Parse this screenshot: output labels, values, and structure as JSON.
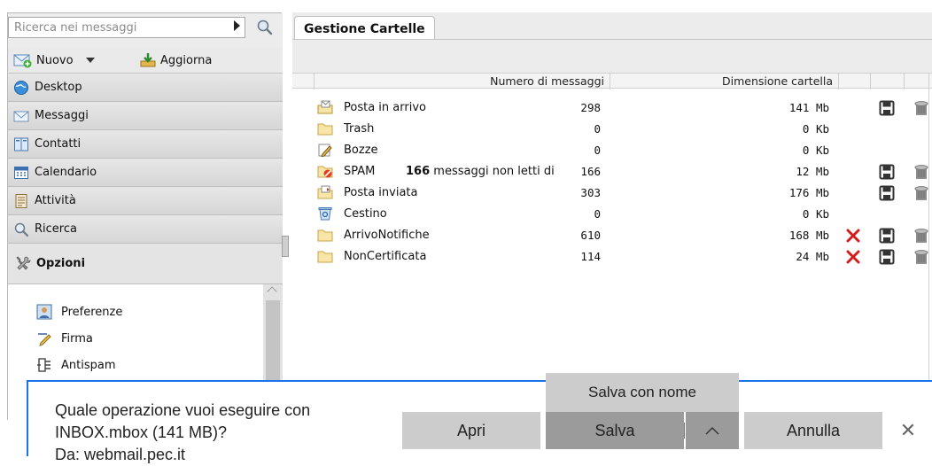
{
  "sidebar": {
    "search_placeholder": "Ricerca nei messaggi",
    "toolbar": {
      "new_label": "Nuovo",
      "refresh_label": "Aggiorna"
    },
    "nav": [
      {
        "label": "Desktop",
        "icon": "globe-icon"
      },
      {
        "label": "Messaggi",
        "icon": "envelope-icon"
      },
      {
        "label": "Contatti",
        "icon": "address-book-icon"
      },
      {
        "label": "Calendario",
        "icon": "calendar-icon"
      },
      {
        "label": "Attività",
        "icon": "task-icon"
      },
      {
        "label": "Ricerca",
        "icon": "search-icon"
      },
      {
        "label": "Opzioni",
        "icon": "tools-icon",
        "active": true
      }
    ],
    "options": [
      {
        "label": "Preferenze",
        "icon": "user-card-icon"
      },
      {
        "label": "Firma",
        "icon": "pen-icon"
      },
      {
        "label": "Antispam",
        "icon": "filter-icon"
      }
    ]
  },
  "main": {
    "tab_label": "Gestione Cartelle",
    "columns": {
      "count": "Numero di messaggi",
      "size": "Dimensione cartella"
    },
    "folders": [
      {
        "name": "Posta in arrivo",
        "count": "298",
        "size": "141 Mb",
        "icon": "inbox-icon",
        "del": false,
        "save": true,
        "trash": true
      },
      {
        "name": "Trash",
        "count": "0",
        "size": "0 Kb",
        "icon": "folder-icon",
        "del": false,
        "save": false,
        "trash": false
      },
      {
        "name": "Bozze",
        "count": "0",
        "size": "0 Kb",
        "icon": "drafts-icon",
        "del": false,
        "save": false,
        "trash": false
      },
      {
        "name": "SPAM",
        "unread_num": "166",
        "unread_text": "messaggi non letti di",
        "count": "166",
        "size": "12 Mb",
        "icon": "spam-icon",
        "del": false,
        "save": true,
        "trash": true
      },
      {
        "name": "Posta inviata",
        "count": "303",
        "size": "176 Mb",
        "icon": "sent-icon",
        "del": false,
        "save": true,
        "trash": true
      },
      {
        "name": "Cestino",
        "count": "0",
        "size": "0 Kb",
        "icon": "recycle-bin-icon",
        "del": false,
        "save": false,
        "trash": false
      },
      {
        "name": "ArrivoNotifiche",
        "count": "610",
        "size": "168 Mb",
        "icon": "folder-icon",
        "del": true,
        "save": true,
        "trash": true
      },
      {
        "name": "NonCertificata",
        "count": "114",
        "size": "24 Mb",
        "icon": "folder-icon",
        "del": true,
        "save": true,
        "trash": true
      }
    ]
  },
  "download_bar": {
    "message_line1": "Quale operazione vuoi eseguire con",
    "message_line2": "INBOX.mbox (141 MB)?",
    "message_line3": "Da: webmail.pec.it",
    "open_label": "Apri",
    "save_label": "Salva",
    "save_as_label": "Salva con nome",
    "cancel_label": "Annulla",
    "close_glyph": "✕",
    "chevron_glyph": "⌃"
  }
}
